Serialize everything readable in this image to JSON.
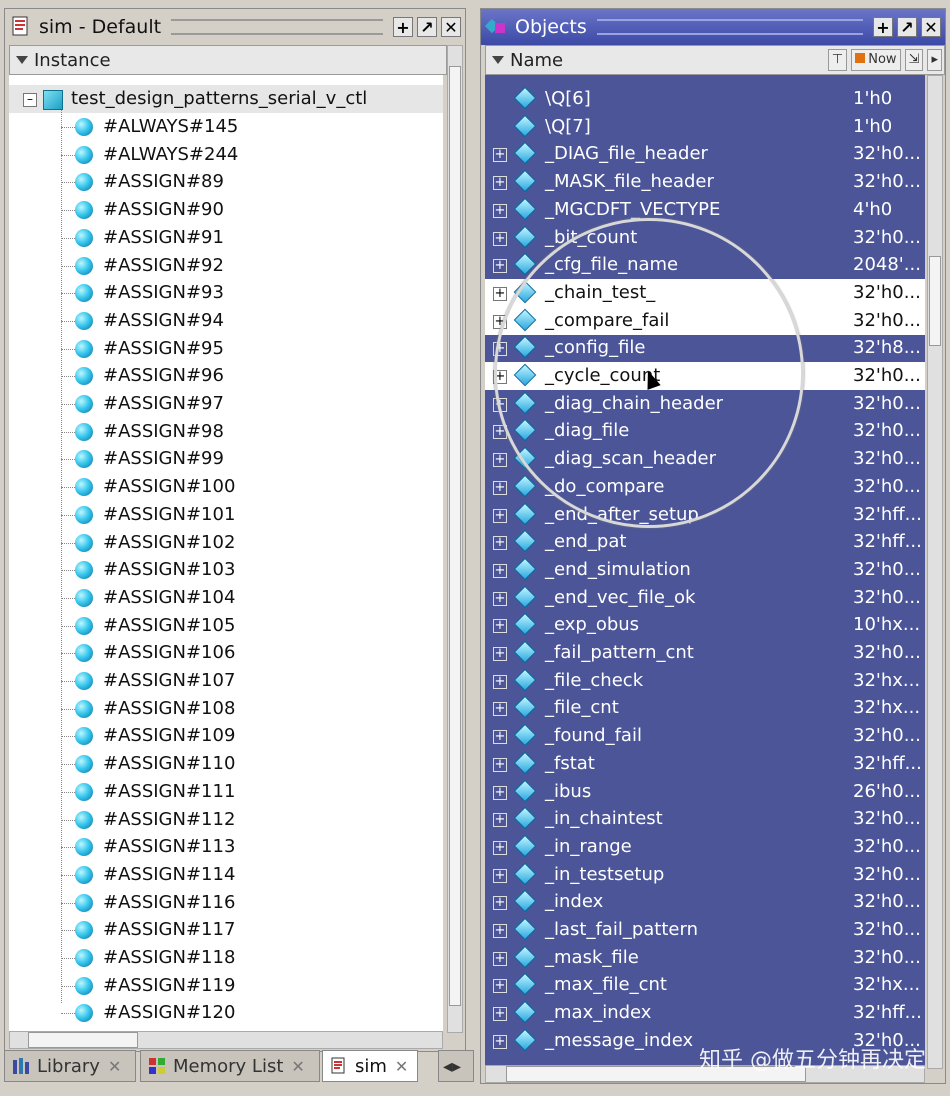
{
  "sim_pane": {
    "title": "sim - Default",
    "column": "Instance",
    "root": "test_design_patterns_serial_v_ctl",
    "items": [
      "#ALWAYS#145",
      "#ALWAYS#244",
      "#ASSIGN#89",
      "#ASSIGN#90",
      "#ASSIGN#91",
      "#ASSIGN#92",
      "#ASSIGN#93",
      "#ASSIGN#94",
      "#ASSIGN#95",
      "#ASSIGN#96",
      "#ASSIGN#97",
      "#ASSIGN#98",
      "#ASSIGN#99",
      "#ASSIGN#100",
      "#ASSIGN#101",
      "#ASSIGN#102",
      "#ASSIGN#103",
      "#ASSIGN#104",
      "#ASSIGN#105",
      "#ASSIGN#106",
      "#ASSIGN#107",
      "#ASSIGN#108",
      "#ASSIGN#109",
      "#ASSIGN#110",
      "#ASSIGN#111",
      "#ASSIGN#112",
      "#ASSIGN#113",
      "#ASSIGN#114",
      "#ASSIGN#116",
      "#ASSIGN#117",
      "#ASSIGN#118",
      "#ASSIGN#119",
      "#ASSIGN#120"
    ]
  },
  "objects_pane": {
    "title": "Objects",
    "column": "Name",
    "now_label": "Now",
    "rows": [
      {
        "name": "\\Q[6]",
        "value": "1'h0",
        "expand": false,
        "selected": false
      },
      {
        "name": "\\Q[7]",
        "value": "1'h0",
        "expand": false,
        "selected": false
      },
      {
        "name": "_DIAG_file_header",
        "value": "32'h0...",
        "expand": true,
        "selected": false
      },
      {
        "name": "_MASK_file_header",
        "value": "32'h0...",
        "expand": true,
        "selected": false
      },
      {
        "name": "_MGCDFT_VECTYPE",
        "value": "4'h0",
        "expand": true,
        "selected": false
      },
      {
        "name": "_bit_count",
        "value": "32'h0...",
        "expand": true,
        "selected": false
      },
      {
        "name": "_cfg_file_name",
        "value": "2048'...",
        "expand": true,
        "selected": false
      },
      {
        "name": "_chain_test_",
        "value": "32'h0...",
        "expand": true,
        "selected": true
      },
      {
        "name": "_compare_fail",
        "value": "32'h0...",
        "expand": true,
        "selected": true
      },
      {
        "name": "_config_file",
        "value": "32'h8...",
        "expand": true,
        "selected": false
      },
      {
        "name": "_cycle_count",
        "value": "32'h0...",
        "expand": true,
        "selected": true
      },
      {
        "name": "_diag_chain_header",
        "value": "32'h0...",
        "expand": true,
        "selected": false
      },
      {
        "name": "_diag_file",
        "value": "32'h0...",
        "expand": true,
        "selected": false
      },
      {
        "name": "_diag_scan_header",
        "value": "32'h0...",
        "expand": true,
        "selected": false
      },
      {
        "name": "_do_compare",
        "value": "32'h0...",
        "expand": true,
        "selected": false
      },
      {
        "name": "_end_after_setup",
        "value": "32'hff...",
        "expand": true,
        "selected": false
      },
      {
        "name": "_end_pat",
        "value": "32'hff...",
        "expand": true,
        "selected": false
      },
      {
        "name": "_end_simulation",
        "value": "32'h0...",
        "expand": true,
        "selected": false
      },
      {
        "name": "_end_vec_file_ok",
        "value": "32'h0...",
        "expand": true,
        "selected": false
      },
      {
        "name": "_exp_obus",
        "value": "10'hx...",
        "expand": true,
        "selected": false
      },
      {
        "name": "_fail_pattern_cnt",
        "value": "32'h0...",
        "expand": true,
        "selected": false
      },
      {
        "name": "_file_check",
        "value": "32'hx...",
        "expand": true,
        "selected": false
      },
      {
        "name": "_file_cnt",
        "value": "32'hx...",
        "expand": true,
        "selected": false
      },
      {
        "name": "_found_fail",
        "value": "32'h0...",
        "expand": true,
        "selected": false
      },
      {
        "name": "_fstat",
        "value": "32'hff...",
        "expand": true,
        "selected": false
      },
      {
        "name": "_ibus",
        "value": "26'h0...",
        "expand": true,
        "selected": false
      },
      {
        "name": "_in_chaintest",
        "value": "32'h0...",
        "expand": true,
        "selected": false
      },
      {
        "name": "_in_range",
        "value": "32'h0...",
        "expand": true,
        "selected": false
      },
      {
        "name": "_in_testsetup",
        "value": "32'h0...",
        "expand": true,
        "selected": false
      },
      {
        "name": "_index",
        "value": "32'h0...",
        "expand": true,
        "selected": false
      },
      {
        "name": "_last_fail_pattern",
        "value": "32'h0...",
        "expand": true,
        "selected": false
      },
      {
        "name": "_mask_file",
        "value": "32'h0...",
        "expand": true,
        "selected": false
      },
      {
        "name": "_max_file_cnt",
        "value": "32'hx...",
        "expand": true,
        "selected": false
      },
      {
        "name": "_max_index",
        "value": "32'hff...",
        "expand": true,
        "selected": false
      },
      {
        "name": "_message_index",
        "value": "32'h0...",
        "expand": true,
        "selected": false
      }
    ]
  },
  "tabs": [
    {
      "label": "Library",
      "active": false
    },
    {
      "label": "Memory List",
      "active": false
    },
    {
      "label": "sim",
      "active": true
    }
  ],
  "watermark": "知乎 @做五分钟再决定"
}
